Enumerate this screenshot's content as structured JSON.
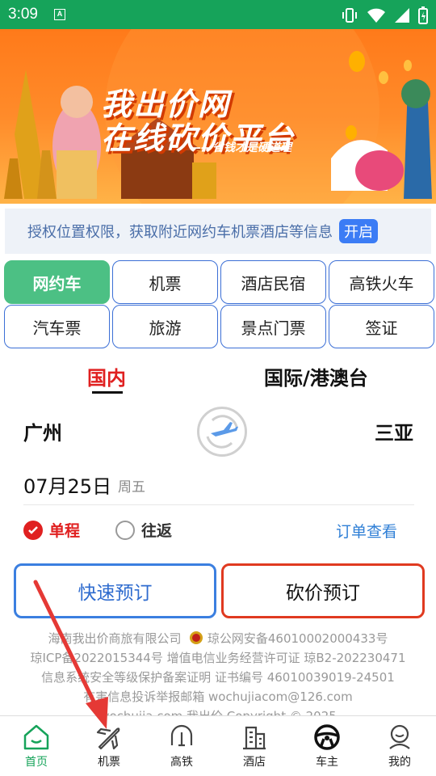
{
  "status": {
    "time": "3:09",
    "app_icon_letter": "A"
  },
  "banner": {
    "line1": "我出价网",
    "line2": "在线砍价平台",
    "slogan": "——省钱才是硬道理"
  },
  "permission": {
    "text": "授权位置权限，获取附近网约车机票酒店等信息",
    "button": "开启"
  },
  "categories": [
    "网约车",
    "机票",
    "酒店民宿",
    "高铁火车",
    "汽车票",
    "旅游",
    "景点门票",
    "签证"
  ],
  "tabs": {
    "domestic": "国内",
    "international": "国际/港澳台"
  },
  "route": {
    "from": "广州",
    "to": "三亚"
  },
  "date": {
    "value": "07月25日",
    "weekday": "周五"
  },
  "trip_type": {
    "one_way": "单程",
    "round_trip": "往返",
    "order_link": "订单查看"
  },
  "buttons": {
    "quick": "快速预订",
    "bargain": "砍价预订"
  },
  "footer": {
    "line1": "海南我出价商旅有限公司",
    "line1b": "琼公网安备46010002000433号",
    "line2": "琼ICP备2022015344号   增值电信业务经营许可证 琼B2-202230471",
    "line3": "信息系统安全等级保护备案证明 证书编号 46010039019-24501",
    "line4": "有害信息投诉举报邮箱 wochujiacom@126.com",
    "line5": "wochujia.com 我出价 Copyright © 2025"
  },
  "tabbar": [
    "首页",
    "机票",
    "高铁",
    "酒店",
    "车主",
    "我的"
  ],
  "colors": {
    "brand_green": "#16a35a",
    "accent_red": "#e02020",
    "link_blue": "#2f7fd6"
  }
}
